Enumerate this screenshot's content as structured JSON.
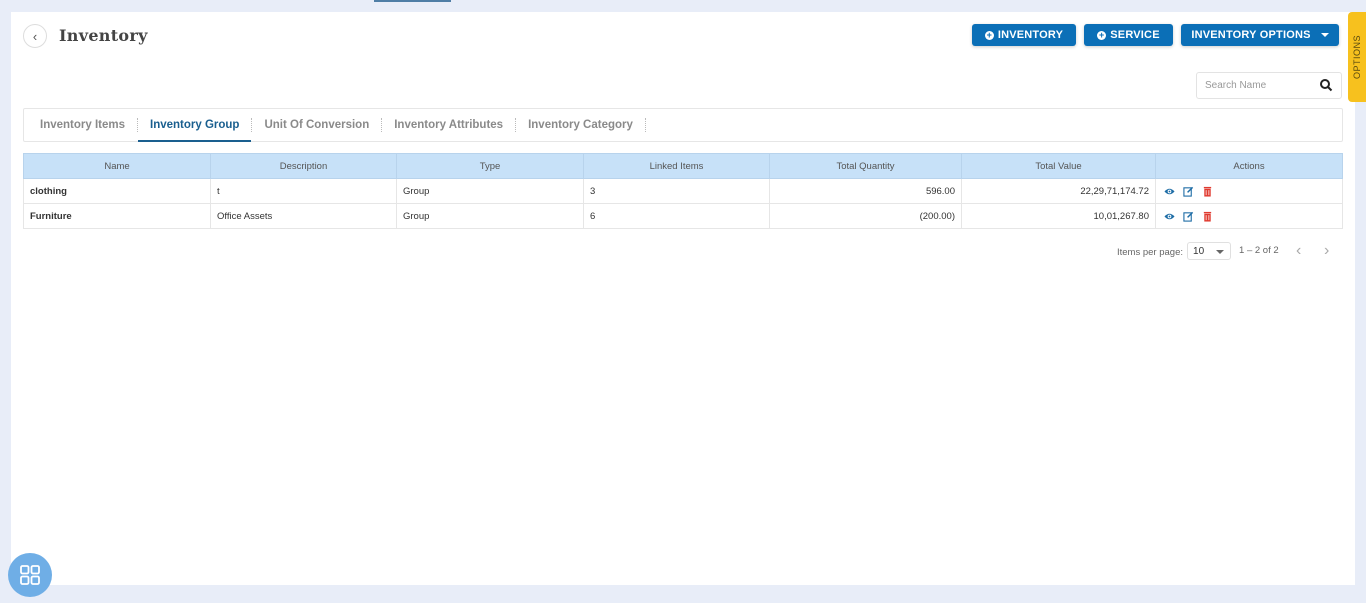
{
  "header": {
    "title": "Inventory",
    "back_icon": "chevron-left-icon",
    "buttons": {
      "inventory": "INVENTORY",
      "service": "SERVICE",
      "inventory_options": "INVENTORY OPTIONS"
    },
    "options_tab": "OPTIONS"
  },
  "search": {
    "placeholder": "Search Name",
    "value": ""
  },
  "tabs": [
    {
      "label": "Inventory Items",
      "active": false
    },
    {
      "label": "Inventory Group",
      "active": true
    },
    {
      "label": "Unit Of Conversion",
      "active": false
    },
    {
      "label": "Inventory Attributes",
      "active": false
    },
    {
      "label": "Inventory Category",
      "active": false
    }
  ],
  "table": {
    "columns": [
      "Name",
      "Description",
      "Type",
      "Linked Items",
      "Total Quantity",
      "Total Value",
      "Actions"
    ],
    "rows": [
      {
        "name": "clothing",
        "description": "t",
        "type": "Group",
        "linked_items": "3",
        "total_quantity": "596.00",
        "total_value": "22,29,71,174.72"
      },
      {
        "name": "Furniture",
        "description": "Office Assets",
        "type": "Group",
        "linked_items": "6",
        "total_quantity": "(200.00)",
        "total_value": "10,01,267.80"
      }
    ]
  },
  "pagination": {
    "items_per_page_label": "Items per page:",
    "items_per_page": "10",
    "range": "1 – 2 of 2"
  },
  "colors": {
    "primary": "#0b6fb7",
    "header_bg": "#c7e1f8",
    "options_tab": "#f7c11e",
    "delete": "#e03a2f",
    "fab": "#6faee6"
  }
}
